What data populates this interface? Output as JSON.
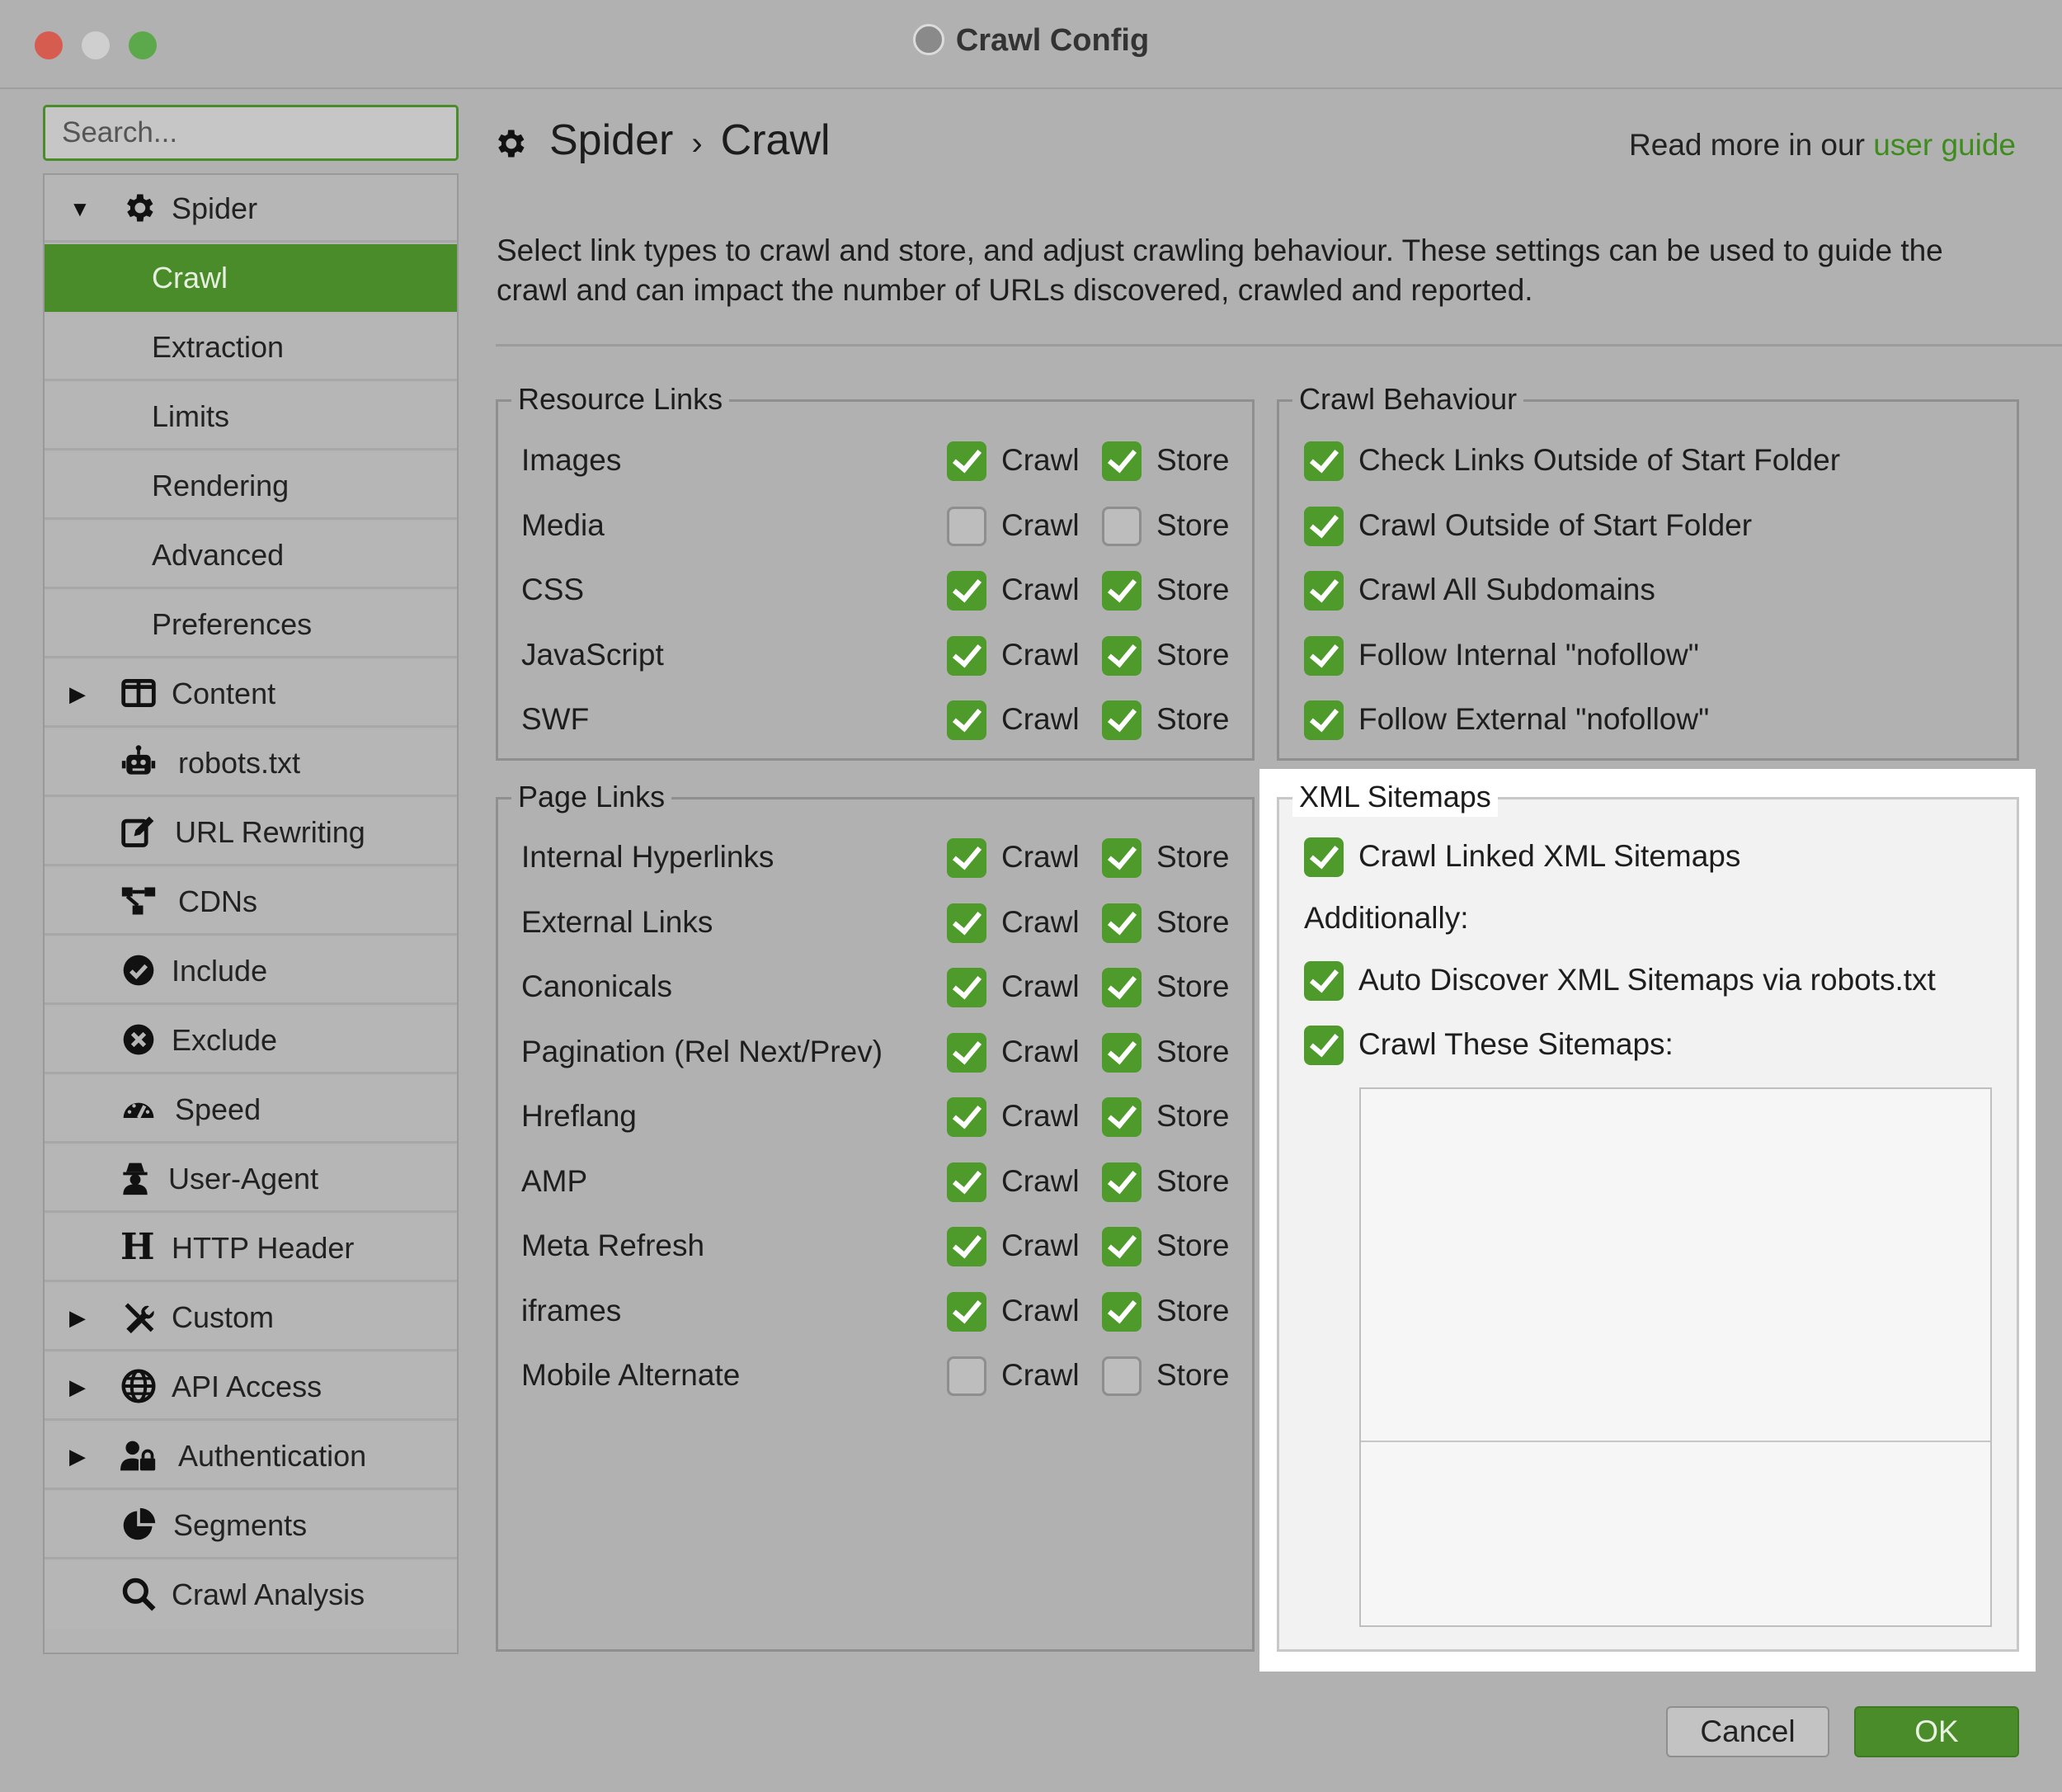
{
  "window": {
    "title": "Crawl Config"
  },
  "search": {
    "placeholder": "Search..."
  },
  "sidebar": {
    "items": [
      {
        "label": "Spider"
      },
      {
        "label": "Crawl"
      },
      {
        "label": "Extraction"
      },
      {
        "label": "Limits"
      },
      {
        "label": "Rendering"
      },
      {
        "label": "Advanced"
      },
      {
        "label": "Preferences"
      },
      {
        "label": "Content"
      },
      {
        "label": "robots.txt"
      },
      {
        "label": "URL Rewriting"
      },
      {
        "label": "CDNs"
      },
      {
        "label": "Include"
      },
      {
        "label": "Exclude"
      },
      {
        "label": "Speed"
      },
      {
        "label": "User-Agent"
      },
      {
        "label": "HTTP Header"
      },
      {
        "label": "Custom"
      },
      {
        "label": "API Access"
      },
      {
        "label": "Authentication"
      },
      {
        "label": "Segments"
      },
      {
        "label": "Crawl Analysis"
      }
    ]
  },
  "header": {
    "crumb_parent": "Spider",
    "crumb_sep": "›",
    "crumb_current": "Crawl",
    "read_more": "Read more in our",
    "guide_link": "user guide"
  },
  "description": "Select link types to crawl and store, and adjust crawling behaviour. These settings can be used to guide the  crawl and can impact the number of URLs discovered, crawled and reported.",
  "labels": {
    "crawl": "Crawl",
    "store": "Store"
  },
  "resource_links": {
    "title": "Resource Links",
    "rows": [
      {
        "label": "Images",
        "crawl": true,
        "store": true
      },
      {
        "label": "Media",
        "crawl": false,
        "store": false
      },
      {
        "label": "CSS",
        "crawl": true,
        "store": true
      },
      {
        "label": "JavaScript",
        "crawl": true,
        "store": true
      },
      {
        "label": "SWF",
        "crawl": true,
        "store": true
      }
    ]
  },
  "page_links": {
    "title": "Page Links",
    "rows": [
      {
        "label": "Internal Hyperlinks",
        "crawl": true,
        "store": true
      },
      {
        "label": "External Links",
        "crawl": true,
        "store": true
      },
      {
        "label": "Canonicals",
        "crawl": true,
        "store": true
      },
      {
        "label": "Pagination (Rel Next/Prev)",
        "crawl": true,
        "store": true
      },
      {
        "label": "Hreflang",
        "crawl": true,
        "store": true
      },
      {
        "label": "AMP",
        "crawl": true,
        "store": true
      },
      {
        "label": "Meta Refresh",
        "crawl": true,
        "store": true
      },
      {
        "label": "iframes",
        "crawl": true,
        "store": true
      },
      {
        "label": "Mobile Alternate",
        "crawl": false,
        "store": false
      }
    ]
  },
  "crawl_behaviour": {
    "title": "Crawl Behaviour",
    "items": [
      {
        "label": "Check Links Outside of Start Folder",
        "checked": true
      },
      {
        "label": "Crawl Outside of Start Folder",
        "checked": true
      },
      {
        "label": "Crawl All Subdomains",
        "checked": true
      },
      {
        "label": "Follow Internal \"nofollow\"",
        "checked": true
      },
      {
        "label": "Follow External \"nofollow\"",
        "checked": true
      }
    ]
  },
  "xml_sitemaps": {
    "title": "XML Sitemaps",
    "crawl_linked": "Crawl Linked XML Sitemaps",
    "additionally": "Additionally:",
    "auto_discover": "Auto Discover XML Sitemaps via robots.txt",
    "crawl_these": "Crawl These Sitemaps:",
    "sitemap_list": ""
  },
  "buttons": {
    "cancel": "Cancel",
    "ok": "OK"
  },
  "colors": {
    "accent": "#4a8c2a",
    "link": "#3f8c1e"
  }
}
